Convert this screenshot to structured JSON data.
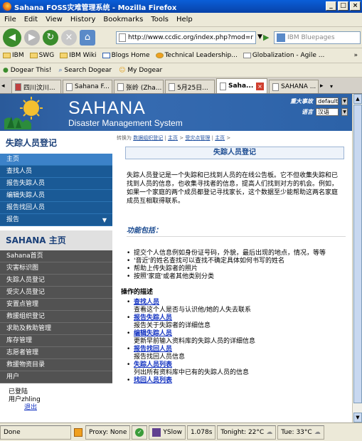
{
  "window": {
    "title": "Sahana FOSS灾难管理系统 - Mozilla Firefox"
  },
  "menubar": [
    "File",
    "Edit",
    "View",
    "History",
    "Bookmarks",
    "Tools",
    "Help"
  ],
  "nav": {
    "url": "http://www.ccdic.org/index.php?mod=r",
    "search_placeholder": "IBM Bluepages"
  },
  "bookmarks": [
    "IBM",
    "SWG",
    "IBM Wiki",
    "Blogs Home",
    "Technical Leadership...",
    "Globalization - Agile ..."
  ],
  "bookmarks2": [
    "Dogear This!",
    "Search Dogear",
    "My Dogear"
  ],
  "tabs": [
    "四川汶川...",
    "Sahana F...",
    "张岭 (Zha...",
    "5月25日...",
    "Saha...",
    "SAHANA ..."
  ],
  "header": {
    "brand": "SAHANA",
    "subtitle": "Disaster Management System",
    "incident_label": "重大事故",
    "incident_value": "default",
    "language_label": "语言",
    "language_value": "汉语"
  },
  "sidebar": {
    "module_title": "失踪人员登记",
    "module_items": [
      "主页",
      "查找人员",
      "报告失踪人员",
      "编辑失踪人员",
      "报告找回人员",
      "报告"
    ],
    "main_title": "SAHANA 主页",
    "main_items": [
      "Sahana首页",
      "灾害标识图",
      "失踪人员登记",
      "受灾人员登记",
      "安置点管理",
      "救援组织登记",
      "求助及救助管理",
      "库存管理",
      "志愿者管理",
      "救援物资目录",
      "用户"
    ],
    "login_status": "已登陆",
    "user_line": "用户zhling",
    "logout": "退出"
  },
  "breadcrumb": {
    "prefix": "转换为",
    "links": [
      "数据组织登记",
      "主页",
      "受灾点管理",
      "主页"
    ]
  },
  "main": {
    "title": "失踪人员登记",
    "intro": "失踪人员登记是一个失踪和已找到人员的在线公告板。它不但收集失踪和已找到人员的信息，也收集寻找者的信息，提高人们找到对方的机会。例如，如果一个家庭的两个成员都登记寻找家长，这个数据至少能帮助这两名家庭成员互相取得联系。",
    "features_title": "功能包括：",
    "features": [
      "提交个人信息例如身份证号码，外貌，最后出现的地点，情况，等等",
      "'音近'的姓名查找可以查找不确定具体如何书写的姓名",
      "帮助上传失踪者的照片",
      "按照'家庭'或者其他类别分类"
    ],
    "ops_title": "操作的描述",
    "ops": [
      {
        "link": "查找人员",
        "desc": "查看这个人是否与认识他/她的人失去联系"
      },
      {
        "link": "报告失踪人员",
        "desc": "报告关于失踪者的详细信息"
      },
      {
        "link": "编辑失踪人员",
        "desc": "更新早前输入资料库的失踪人员的详细信息"
      },
      {
        "link": "报告找回人员",
        "desc": "报告找回人员信息"
      },
      {
        "link": "失踪人员列表",
        "desc": "列出所有资料库中已有的失踪人员的信息"
      },
      {
        "link": "找回人员列表",
        "desc": ""
      }
    ]
  },
  "status": {
    "done": "Done",
    "proxy": "Proxy: None",
    "yslow": "YSlow",
    "time": "1.078s",
    "tonight": "Tonight: 22°C",
    "tue": "Tue: 33°C"
  }
}
